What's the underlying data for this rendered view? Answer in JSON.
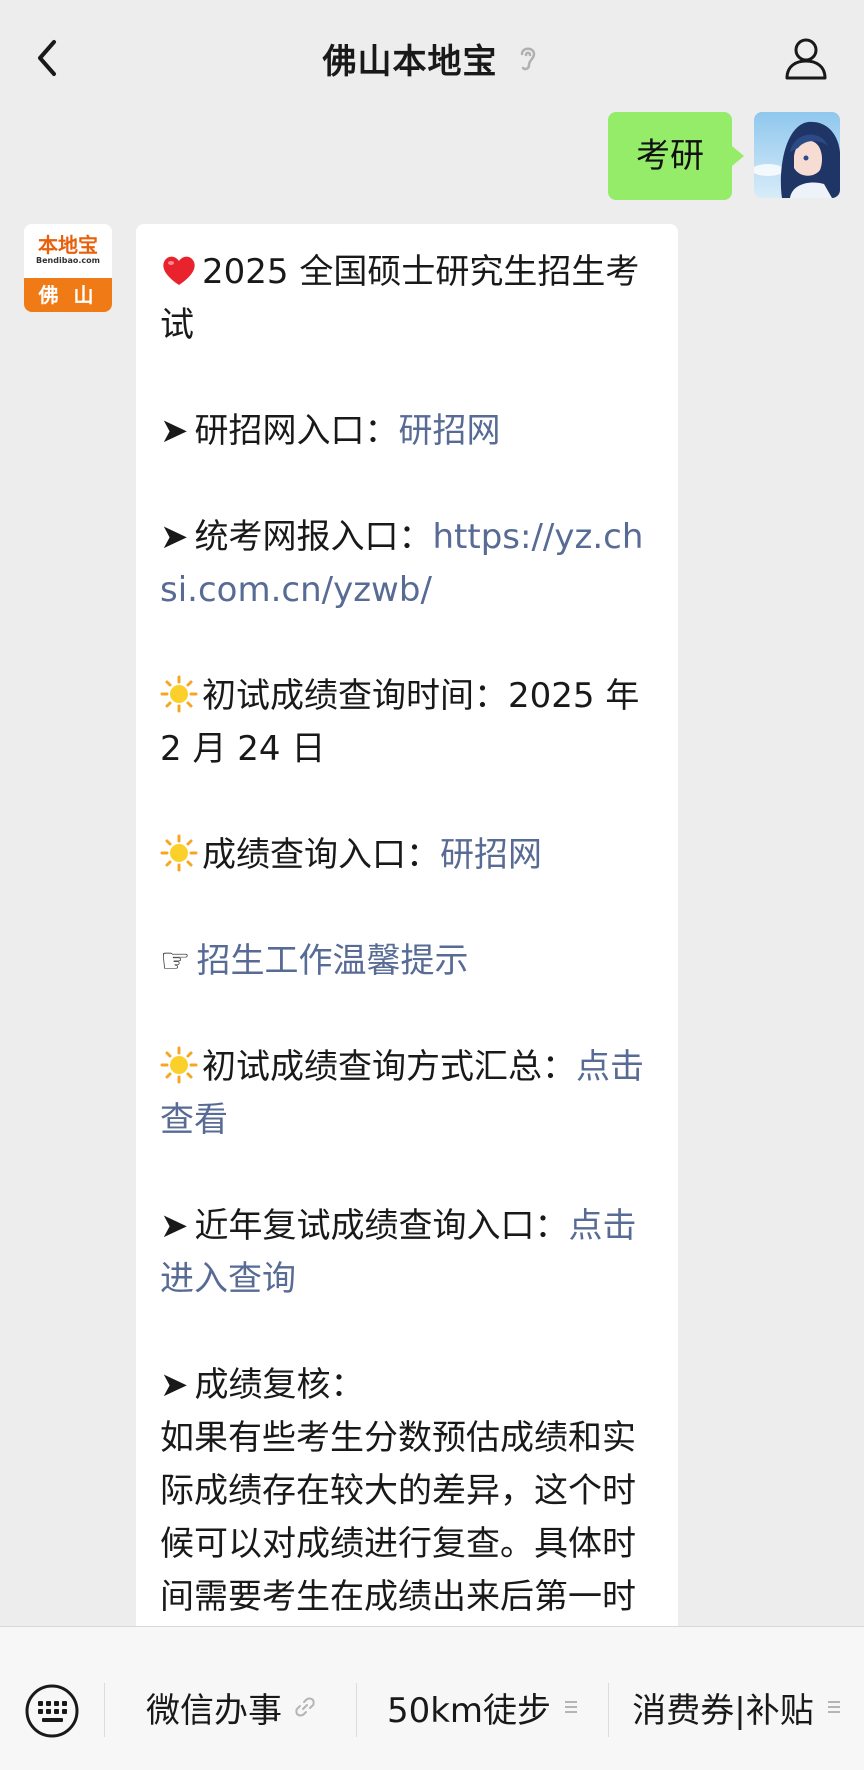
{
  "header": {
    "title": "佛山本地宝",
    "back_icon": "chevron-left-icon",
    "ear_icon": "ear-icon",
    "profile_icon": "person-icon"
  },
  "my_message": {
    "text": "考研"
  },
  "their_avatar": {
    "name": "本地宝",
    "url": "Bendibao.com",
    "city": "佛 山"
  },
  "their_message": {
    "l1": "2025 全国硕士研究生招生考试",
    "l2_label": "研招网入口：",
    "l2_link": "研招网",
    "l3_label": "统考网报入口：",
    "l3_link": "https://yz.chsi.com.cn/yzwb/",
    "l4": "初试成绩查询时间：2025 年 2 月 24 日",
    "l5_label": "成绩查询入口：",
    "l5_link": "研招网",
    "l6_link": "招生工作温馨提示",
    "l7_label": "初试成绩查询方式汇总：",
    "l7_link": "点击查看",
    "l8_label": "近年复试成绩查询入口：",
    "l8_link": "点击进入查询",
    "l9": "成绩复核：",
    "l10": "如果有些考生分数预估成绩和实际成绩存在较大的差异，这个时候可以对成绩进行复查。具体时间需要考生在成绩出来后第一时间查询省区市或者招生单位发布的信息。"
  },
  "bottom_menu": {
    "keyboard_icon": "keyboard-icon",
    "items": [
      {
        "label": "微信办事",
        "icon": "link-icon"
      },
      {
        "label": "50km徒步",
        "icon": "menu-lines-icon"
      },
      {
        "label": "消费券|补贴",
        "icon": "menu-lines-icon"
      }
    ]
  },
  "colors": {
    "background": "#ededed",
    "my_bubble": "#95ec69",
    "link": "#576b95",
    "logo_orange": "#f07b16"
  }
}
